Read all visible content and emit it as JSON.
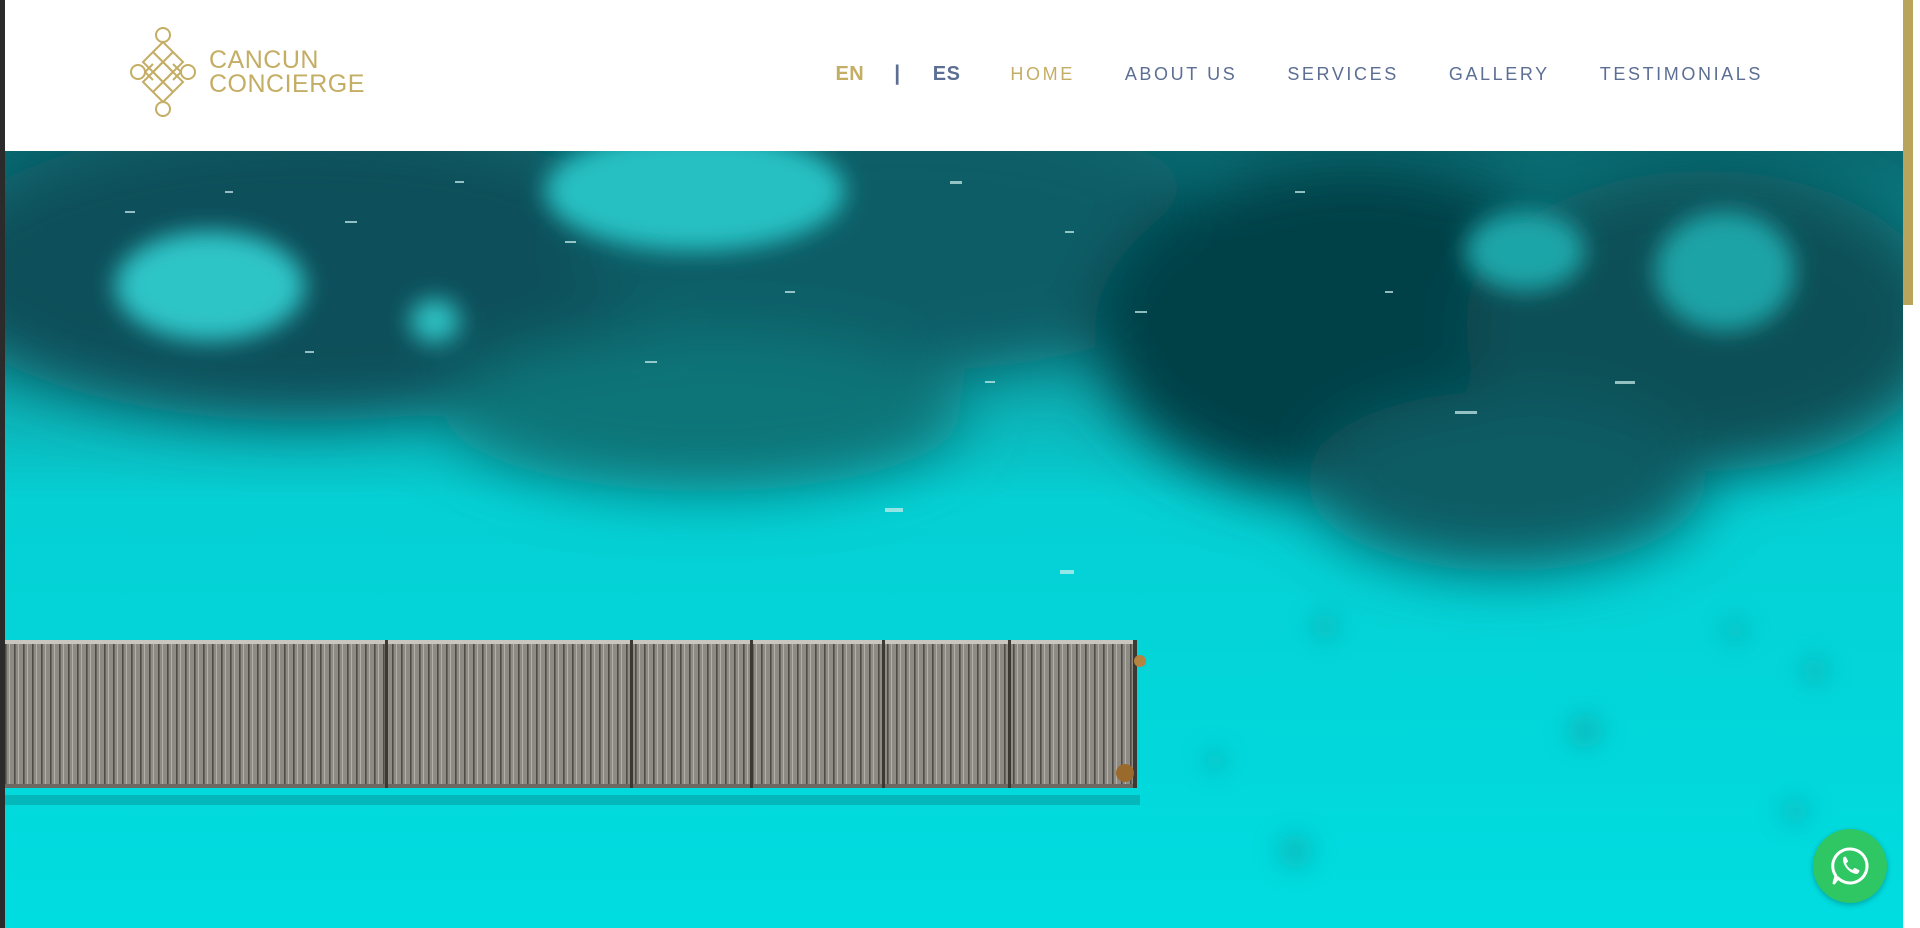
{
  "brand": {
    "line1": "CANCUN",
    "line2": "CONCIERGE",
    "logo_icon": "knot-logo-icon",
    "color": "#c4ad64"
  },
  "languages": {
    "en": "EN",
    "separator": "|",
    "es": "ES",
    "active": "EN"
  },
  "nav": {
    "items": [
      {
        "label": "HOME",
        "active": true
      },
      {
        "label": "ABOUT US",
        "active": false
      },
      {
        "label": "SERVICES",
        "active": false
      },
      {
        "label": "GALLERY",
        "active": false
      },
      {
        "label": "TESTIMONIALS",
        "active": false
      }
    ],
    "text_color": "#5c6e94",
    "active_color": "#c4ad64"
  },
  "hero": {
    "subject": "aerial view of wooden pier over turquoise sea",
    "water_color": "#00d9dc",
    "deep_water_color": "#0b5f66"
  },
  "whatsapp": {
    "icon": "whatsapp-icon",
    "color": "#2fc763"
  },
  "scrollbar": {
    "thumb_color": "#b9a45b"
  }
}
